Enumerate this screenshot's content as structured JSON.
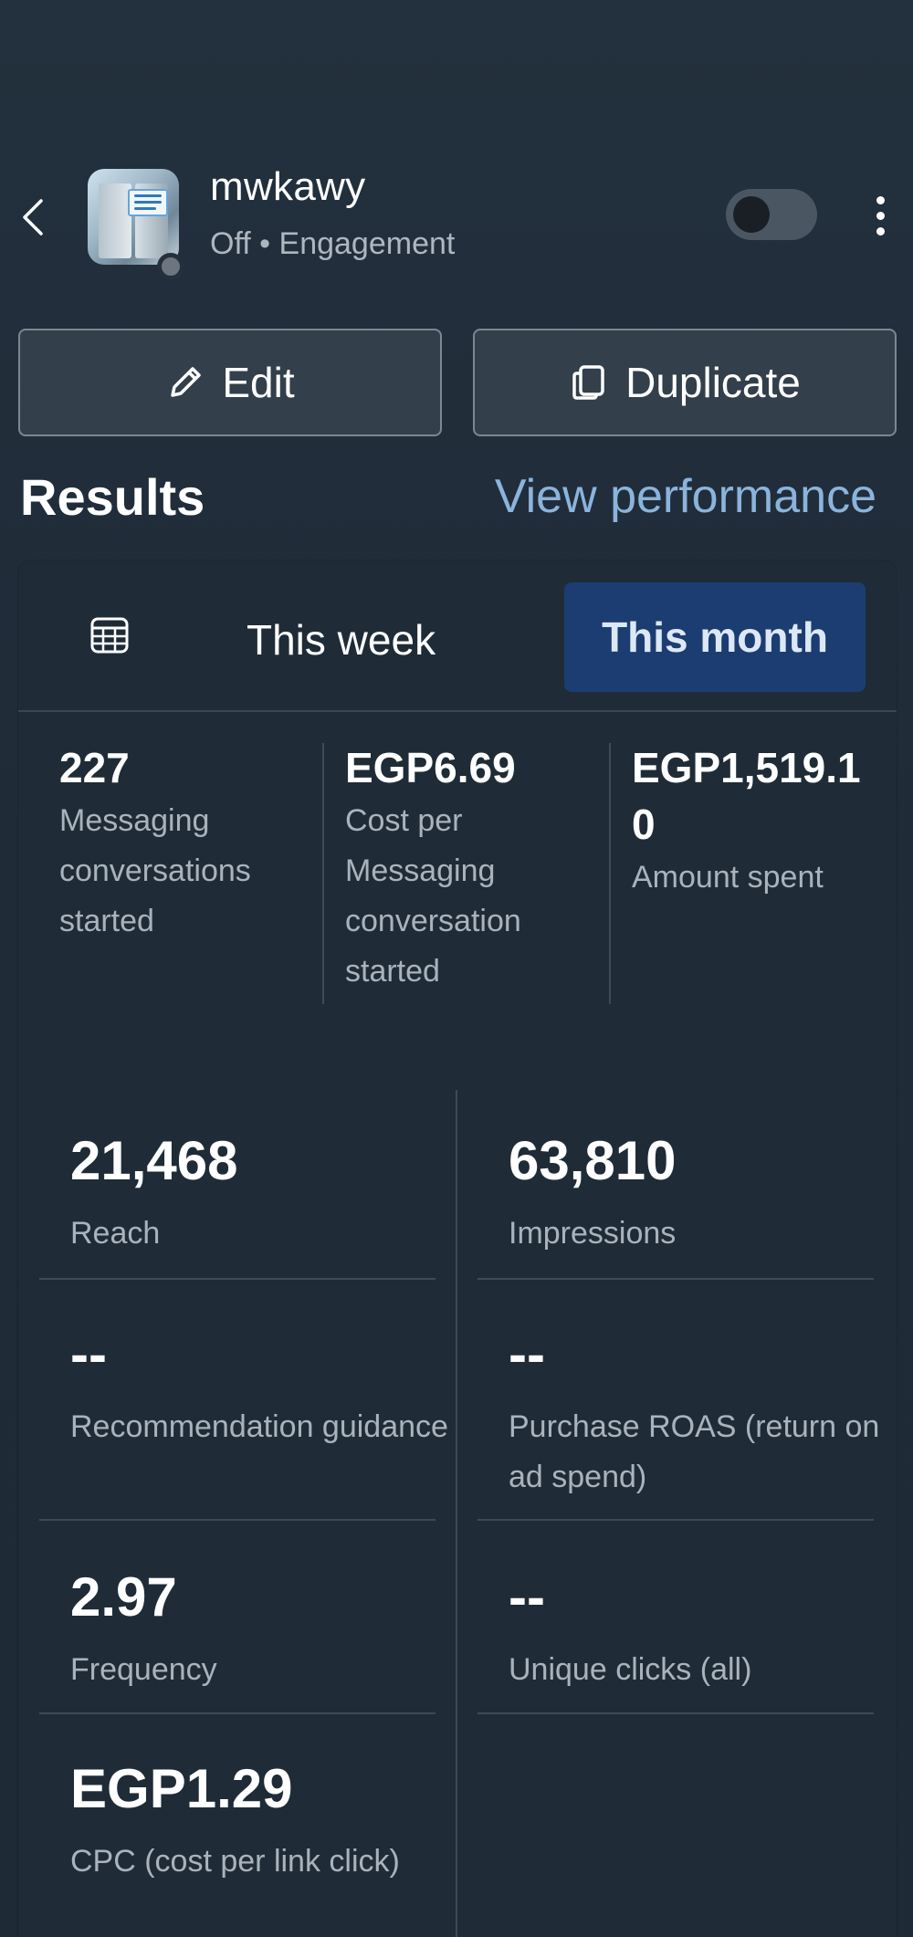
{
  "header": {
    "title": "mwkawy",
    "subtitle": "Off • Engagement",
    "toggle_state": "off"
  },
  "actions": {
    "edit_label": "Edit",
    "duplicate_label": "Duplicate"
  },
  "results": {
    "title": "Results",
    "view_performance_label": "View performance"
  },
  "tabs": {
    "week_label": "This week",
    "month_label": "This month",
    "selected": "This month"
  },
  "top_metrics": [
    {
      "value": "227",
      "label": "Messaging conversations started"
    },
    {
      "value": "EGP6.69",
      "label": "Cost per Messaging conversation started"
    },
    {
      "value": "EGP1,519.10",
      "label": "Amount spent"
    }
  ],
  "metrics": [
    {
      "value": "21,468",
      "label": "Reach"
    },
    {
      "value": "63,810",
      "label": "Impressions"
    },
    {
      "value": "--",
      "label": "Recommendation guidance"
    },
    {
      "value": "--",
      "label": "Purchase ROAS (return on ad spend)"
    },
    {
      "value": "2.97",
      "label": "Frequency"
    },
    {
      "value": "--",
      "label": "Unique clicks (all)"
    },
    {
      "value": "EGP1.29",
      "label": "CPC (cost per link click)"
    }
  ],
  "colors": {
    "background": "#1f2b37",
    "selected_tab": "#1b3d72",
    "link": "#8bb4dc",
    "muted_text": "#aab3bc"
  }
}
